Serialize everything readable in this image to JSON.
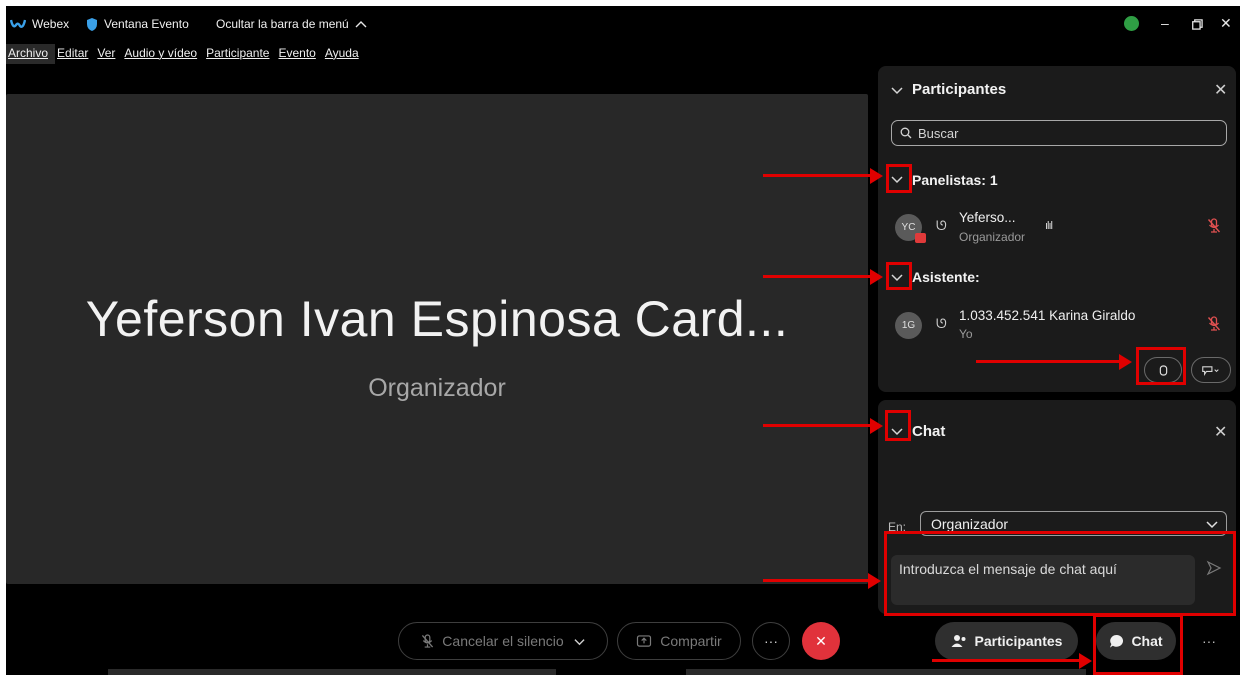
{
  "titlebar": {
    "app_name": "Webex",
    "window_name": "Ventana Evento",
    "hide_menu": "Ocultar la barra de menú",
    "hide_menu_icon": "chevron-up-icon",
    "status_color": "#2f9e44",
    "controls": [
      "minimize-icon",
      "restore-icon",
      "close-icon"
    ]
  },
  "menubar": {
    "items": [
      {
        "label": "Archivo"
      },
      {
        "label": "Editar"
      },
      {
        "label": "Ver"
      },
      {
        "label": "Audio y vídeo"
      },
      {
        "label": "Participante"
      },
      {
        "label": "Evento"
      },
      {
        "label": "Ayuda"
      }
    ]
  },
  "stage": {
    "name": "Yeferson Ivan Espinosa Card...",
    "role": "Organizador"
  },
  "participants_panel": {
    "title": "Participantes",
    "search_placeholder": "Buscar",
    "panelists_label": "Panelistas: 1",
    "panelists": [
      {
        "initials": "YC",
        "name": "Yeferso...",
        "role": "Organizador"
      }
    ],
    "attendees_label": "Asistente:",
    "attendees": [
      {
        "initials": "1G",
        "name": "1.033.452.541 Karina Giraldo",
        "role": "Yo"
      }
    ]
  },
  "chat_panel": {
    "title": "Chat",
    "to_label": "En:",
    "to_value": "Organizador",
    "message_placeholder": "Introduzca el mensaje de chat aquí"
  },
  "controls": {
    "mute_label": "Cancelar el silencio",
    "share_label": "Compartir",
    "more_label": "···",
    "leave_label": "✕",
    "participants_label": "Participantes",
    "chat_label": "Chat",
    "overflow_label": "···"
  },
  "colors": {
    "annotation": "#e00000",
    "leave": "#e1323b",
    "mic_off": "#e05050"
  }
}
